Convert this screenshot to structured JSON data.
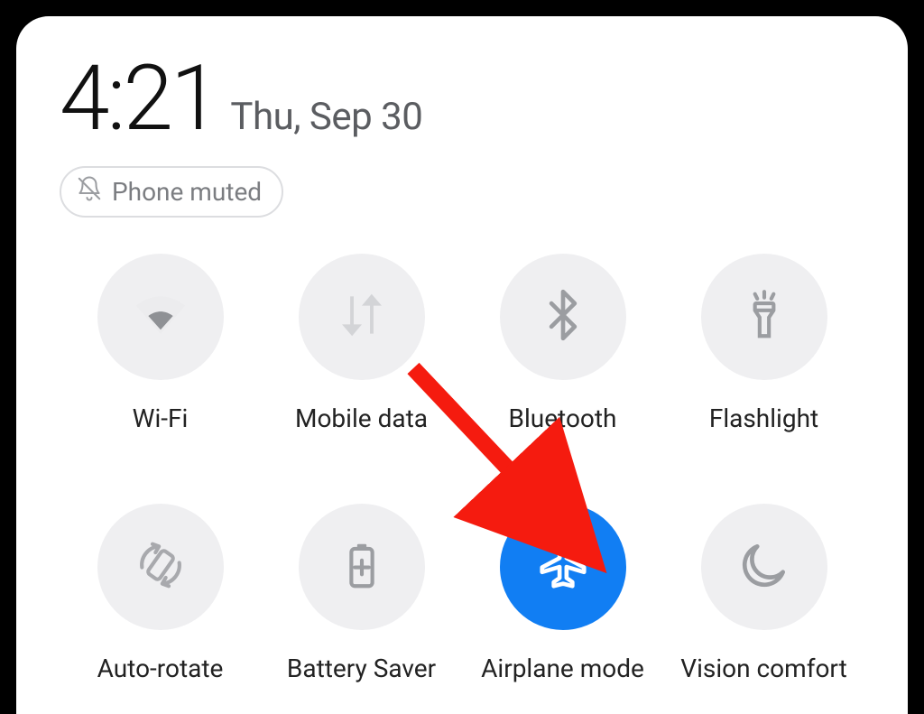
{
  "header": {
    "time": "4:21",
    "date": "Thu, Sep 30"
  },
  "status_chip": {
    "label": "Phone muted"
  },
  "tiles": {
    "wifi": {
      "label": "Wi-Fi",
      "active": false
    },
    "mobile_data": {
      "label": "Mobile data",
      "active": false
    },
    "bluetooth": {
      "label": "Bluetooth",
      "active": false
    },
    "flashlight": {
      "label": "Flashlight",
      "active": false
    },
    "auto_rotate": {
      "label": "Auto-rotate",
      "active": false
    },
    "battery_saver": {
      "label": "Battery Saver",
      "active": false
    },
    "airplane": {
      "label": "Airplane mode",
      "active": true
    },
    "vision": {
      "label": "Vision comfort",
      "active": false
    }
  },
  "colors": {
    "accent": "#117ef3",
    "icon_inactive": "#9b9da1",
    "arrow": "#f51b0f"
  }
}
